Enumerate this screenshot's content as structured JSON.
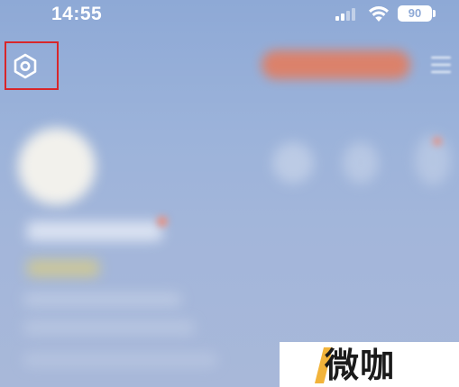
{
  "status_bar": {
    "time": "14:55",
    "battery_level": "90",
    "icons": [
      "signal-icon",
      "wifi-icon",
      "battery-icon"
    ]
  },
  "top_bar": {
    "settings_icon": "settings-hexagon-icon",
    "menu_icon": "menu-lines-icon",
    "highlight_color": "#d8262a"
  },
  "watermark": {
    "text": "微咖",
    "accent_color": "#f2b33a"
  },
  "colors": {
    "background_top": "#8ea9d6",
    "background_bottom": "#a8b8d9",
    "accent_orange": "#e87a58"
  }
}
